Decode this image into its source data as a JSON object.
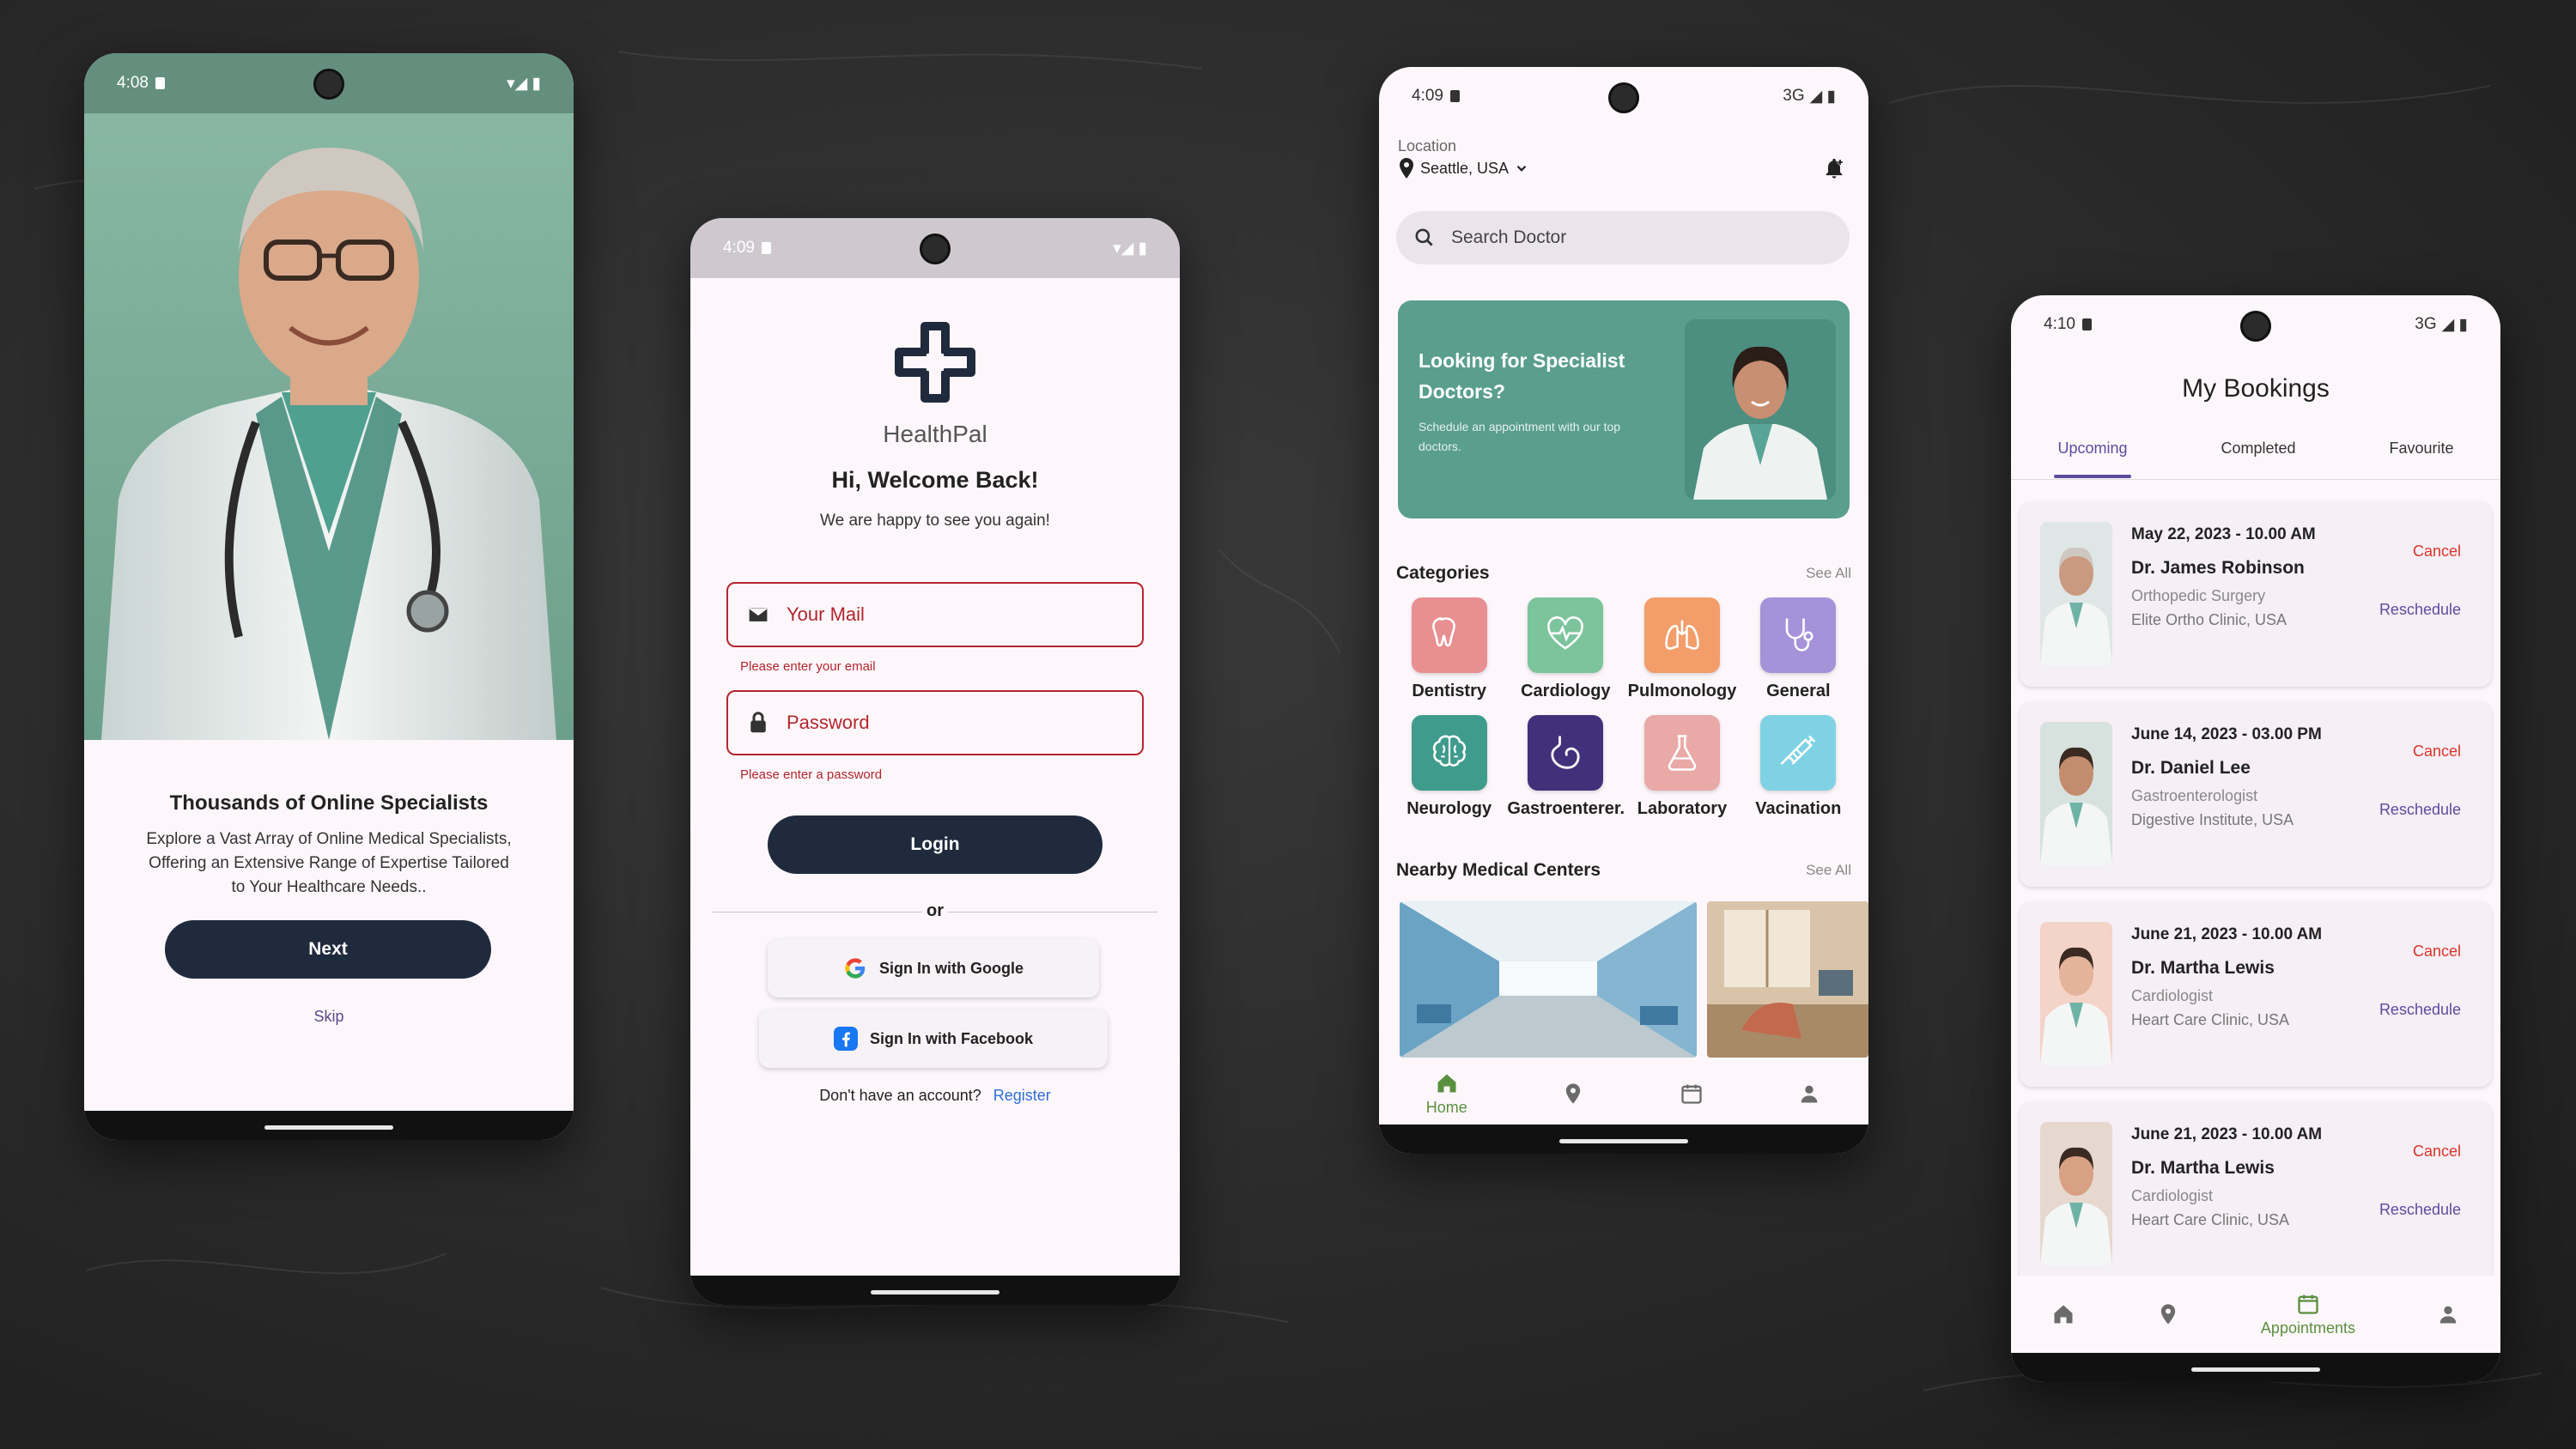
{
  "colors": {
    "background": "#2a2a2a",
    "primary_dark": "#1f2a3d",
    "accent_green": "#5a8f3f",
    "accent_purple": "#5d4c9c",
    "error_red": "#b3262d",
    "banner_teal": "#5a9e8e"
  },
  "onboarding": {
    "status_time": "4:08",
    "title": "Thousands of Online Specialists",
    "description": "Explore a Vast Array of Online Medical Specialists, Offering an Extensive Range of Expertise Tailored to Your Healthcare Needs..",
    "next_label": "Next",
    "skip_label": "Skip"
  },
  "login": {
    "status_time": "4:09",
    "brand": "HealthPal",
    "welcome": "Hi, Welcome Back!",
    "subtitle": "We are happy to see you again!",
    "email_placeholder": "Your Mail",
    "email_error": "Please enter your email",
    "password_placeholder": "Password",
    "password_error": "Please enter a password",
    "login_label": "Login",
    "or_label": "or",
    "google_label": "Sign In with Google",
    "facebook_label": "Sign In with Facebook",
    "no_account": "Don't have an account?",
    "register_label": "Register"
  },
  "home": {
    "status_time": "4:09",
    "status_network": "3G",
    "location_label": "Location",
    "location_value": "Seattle, USA",
    "search_placeholder": "Search Doctor",
    "banner_title": "Looking for Specialist Doctors?",
    "banner_subtitle": "Schedule an appointment with our top doctors.",
    "categories_title": "Categories",
    "see_all": "See All",
    "categories": [
      {
        "label": "Dentistry",
        "color": "#e88f91",
        "icon": "tooth-icon"
      },
      {
        "label": "Cardiology",
        "color": "#7cc49b",
        "icon": "heart-pulse-icon"
      },
      {
        "label": "Pulmonology",
        "color": "#f29d6a",
        "icon": "lungs-icon"
      },
      {
        "label": "General",
        "color": "#a592d9",
        "icon": "stethoscope-icon"
      },
      {
        "label": "Neurology",
        "color": "#3f9c8c",
        "icon": "brain-icon"
      },
      {
        "label": "Gastroenterer...",
        "color": "#43307a",
        "icon": "stomach-icon"
      },
      {
        "label": "Laboratory",
        "color": "#e9a9a6",
        "icon": "flask-icon"
      },
      {
        "label": "Vacination",
        "color": "#7fd2e3",
        "icon": "syringe-icon"
      }
    ],
    "nearby_title": "Nearby Medical Centers",
    "nearby_see_all": "See All",
    "tab_home": "Home"
  },
  "bookings": {
    "status_time": "4:10",
    "status_network": "3G",
    "title": "My Bookings",
    "tabs": [
      "Upcoming",
      "Completed",
      "Favourite"
    ],
    "cancel_label": "Cancel",
    "reschedule_label": "Reschedule",
    "items": [
      {
        "date": "May 22, 2023 - 10.00 AM",
        "doctor": "Dr. James Robinson",
        "specialty": "Orthopedic Surgery",
        "clinic": "Elite Ortho Clinic, USA"
      },
      {
        "date": "June 14, 2023 - 03.00 PM",
        "doctor": "Dr. Daniel Lee",
        "specialty": "Gastroenterologist",
        "clinic": "Digestive Institute, USA"
      },
      {
        "date": "June 21, 2023 - 10.00 AM",
        "doctor": "Dr. Martha Lewis",
        "specialty": "Cardiologist",
        "clinic": "Heart Care Clinic, USA"
      },
      {
        "date": "June 21, 2023 - 10.00 AM",
        "doctor": "Dr. Martha Lewis",
        "specialty": "Cardiologist",
        "clinic": "Heart Care Clinic, USA"
      }
    ],
    "tab_appointments": "Appointments"
  }
}
